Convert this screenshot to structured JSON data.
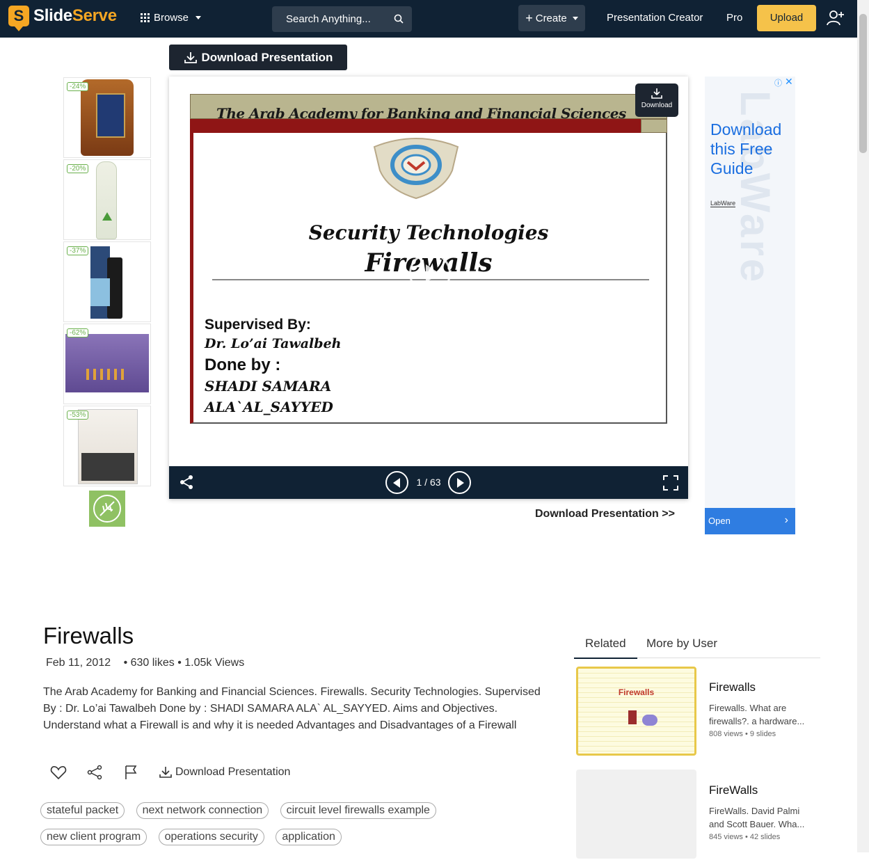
{
  "header": {
    "logo_letter": "S",
    "logo_slide": "Slide",
    "logo_serve": "Serve",
    "browse_label": "Browse",
    "search_placeholder": "Search Anything...",
    "create_label": "Create",
    "presentation_creator": "Presentation Creator",
    "pro": "Pro",
    "upload": "Upload"
  },
  "download_top": "Download Presentation",
  "left_ads": [
    {
      "discount": "-24%",
      "icon": "honey-jar-product"
    },
    {
      "discount": "-20%",
      "icon": "tube-product"
    },
    {
      "discount": "-37%",
      "icon": "serum-bottle-product"
    },
    {
      "discount": "-62%",
      "icon": "ampoule-box-product"
    },
    {
      "discount": "-53%",
      "icon": "skincare-set-product"
    }
  ],
  "slide": {
    "band_text": "The Arab Academy for Banking and Financial Sciences",
    "title1": "Security Technologies",
    "title2": "Firewalls",
    "supervised_label": "Supervised By:",
    "supervisor": "Dr. Lo’ai Tawalbeh",
    "done_label": "Done by :",
    "author1": "SHADI SAMARA",
    "author2": "ALA`AL_SAYYED"
  },
  "viewer": {
    "download_corner": "Download",
    "page_current": "1",
    "page_total": "63",
    "page_text": "1 / 63"
  },
  "download_link": "Download Presentation >>",
  "right_ad": {
    "title": "Download this Free Guide",
    "brand": "LabWare",
    "background_word": "LabWare",
    "open": "Open"
  },
  "doc": {
    "title": "Firewalls",
    "date": "Feb 11, 2012",
    "stats": "• 630 likes • 1.05k Views",
    "description": "The Arab Academy for Banking and Financial Sciences. Firewalls. Security Technologies. Supervised By : Dr. Lo’ai Tawalbeh Done by : SHADI SAMARA ALA` AL_SAYYED. Aims and Objectives. Understand what a Firewall is and why it is needed Advantages and Disadvantages of a Firewall",
    "download_label": "Download Presentation"
  },
  "tags": [
    "stateful packet",
    "next network connection",
    "circuit level firewalls example",
    "new client program",
    "operations security",
    "application"
  ],
  "sidebar": {
    "tab_related": "Related",
    "tab_more": "More by User",
    "items": [
      {
        "title": "Firewalls",
        "desc": "Firewalls. What are firewalls?. a hardware...",
        "meta": "808 views • 9 slides",
        "thumb_text": "Firewalls"
      },
      {
        "title": "FireWalls",
        "desc": "FireWalls. David Palmi and Scott Bauer. Wha...",
        "meta": "845 views • 42 slides"
      }
    ]
  },
  "colors": {
    "topbar": "#102234",
    "accent": "#f5a623",
    "upload": "#f5c24a",
    "slide_red": "#8f1515",
    "ad_blue": "#1a6ee0"
  }
}
